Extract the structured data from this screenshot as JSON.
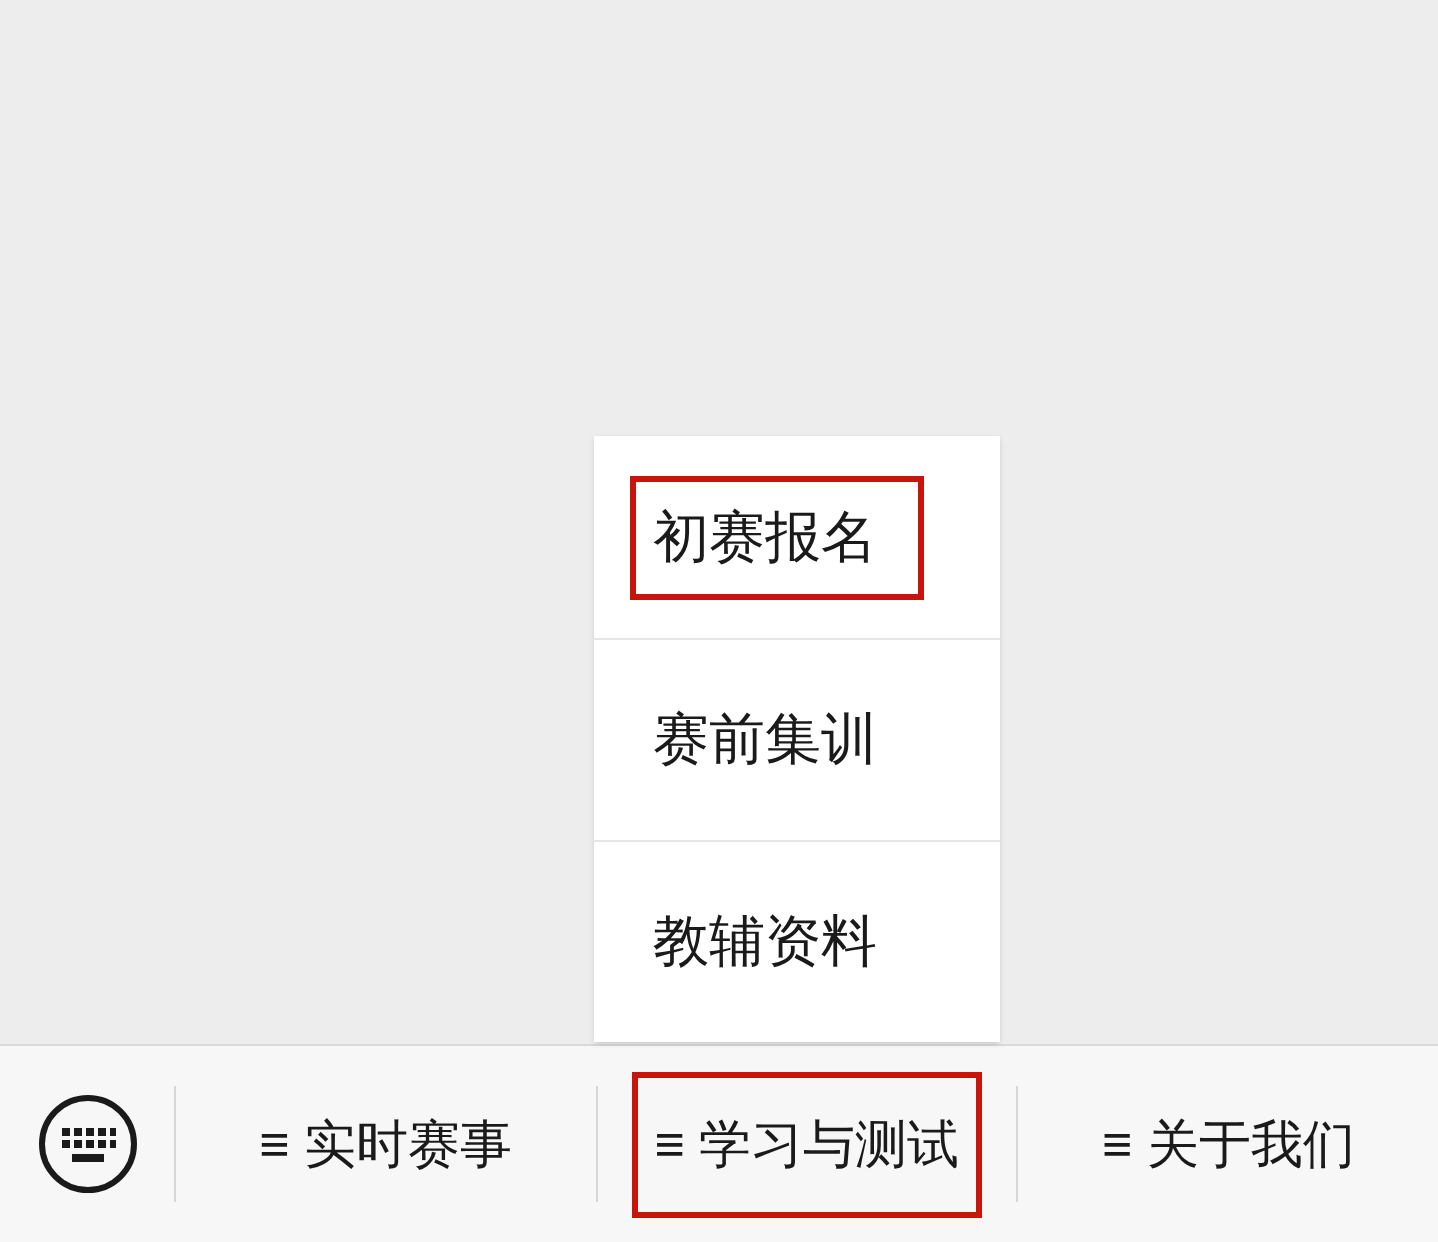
{
  "menu_bar": {
    "items": [
      {
        "label": "≡ 实时赛事",
        "highlighted": false
      },
      {
        "label": "≡ 学习与测试",
        "highlighted": true,
        "submenu": [
          {
            "label": "初赛报名",
            "highlighted": true
          },
          {
            "label": "赛前集训",
            "highlighted": false
          },
          {
            "label": "教辅资料",
            "highlighted": false
          }
        ]
      },
      {
        "label": "≡ 关于我们",
        "highlighted": false
      }
    ]
  }
}
